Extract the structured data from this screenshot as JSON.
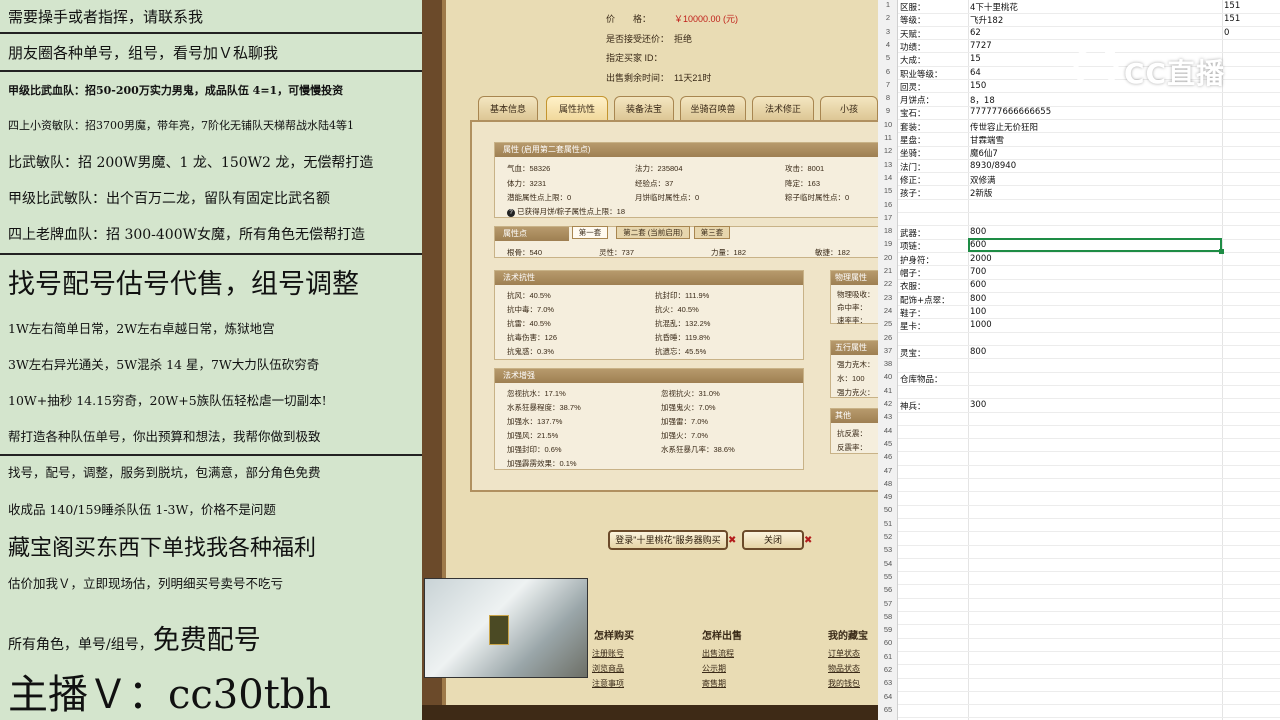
{
  "stream_ads": {
    "lines": [
      "需要操手或者指挥，请联系我",
      "朋友圈各种单号，组号，看号加Ｖ私聊我",
      "甲级比武血队：招50-200万实力男鬼，成品队伍 4=1，可慢慢投资",
      "四上小资敏队：招3700男魔，带年亮，7阶化无铺队天梯帮战水陆4等1",
      "比武敏队：招 200W男魔、1 龙、150W2 龙，无偿帮打造",
      "甲级比武敏队：出个百万二龙，留队有固定比武名额",
      "四上老牌血队：招 300-400W女魔，所有角色无偿帮打造",
      "找号配号估号代售，组号调整",
      "1W左右简单日常，2W左右卓越日常，炼狱地宫",
      "3W左右异光通关，5W混杀 14 星，7W大力队伍砍穷奇",
      "10W+抽秒 14.15穷奇，20W+5族队伍轻松虐一切副本!",
      "帮打造各种队伍单号，你出预算和想法，我帮你做到极致",
      "找号，配号，调整，服务到脱坑，包满意，部分角色免费",
      "收成品 140/159睡杀队伍 1-3W，价格不是问题",
      "藏宝阁买东西下单找我各种福利",
      "估价加我Ｖ，立即现场估，列明细买号卖号不吃亏",
      "所有角色，单号/组号，",
      "免费配号",
      "主播Ｖ：cc30tbh"
    ]
  },
  "trade_panel": {
    "price_label": "价　　格：",
    "price_value": "￥10000.00 (元)",
    "counter_offer_label": "是否接受还价：",
    "counter_offer_value": "拒绝",
    "buyer_label": "指定买家 ID：",
    "time_left_label": "出售剩余时间：",
    "time_left_value": "11天21时",
    "tabs": [
      "基本信息",
      "属性抗性",
      "装备法宝",
      "坐骑召唤兽",
      "法术修正",
      "小孩"
    ],
    "attr_box": {
      "title": "属性 (启用第二套属性点)",
      "rows": [
        [
          "气血：58326",
          "法力：235804",
          "攻击：8001"
        ],
        [
          "体力：3231",
          "经验点：37",
          "降定：163"
        ],
        [
          "潜能属性点上限：0",
          "月饼临时属性点：0",
          "粽子临时属性点：0"
        ]
      ],
      "note": "已获得月饼/粽子属性点上限：18",
      "note_icon": "question-icon"
    },
    "points_box": {
      "title": "属性点",
      "subtabs": [
        "第一套",
        "第二套 (当前启用)",
        "第三套"
      ],
      "row": [
        "根骨：540",
        "灵性：737",
        "力量：182",
        "敏捷：182"
      ]
    },
    "resist_box": {
      "title": "法术抗性",
      "rows": [
        [
          "抗风：40.5%",
          "抗封印：111.9%"
        ],
        [
          "抗中毒：7.0%",
          "抗火：40.5%"
        ],
        [
          "抗雷：40.5%",
          "抗混乱：132.2%"
        ],
        [
          "抗毒伤害：126",
          "抗昏睡：119.8%"
        ],
        [
          "抗鬼惑：0.3%",
          "抗遗忘：45.5%"
        ]
      ]
    },
    "enhance_box": {
      "title": "法术增强",
      "rows": [
        [
          "忽视抗水：17.1%",
          "忽视抗火：31.0%"
        ],
        [
          "水系狂暴程度：38.7%",
          "加强鬼火：7.0%"
        ],
        [
          "加强水：137.7%",
          "加强雷：7.0%"
        ],
        [
          "加强风：21.5%",
          "加强火：7.0%"
        ],
        [
          "加强封印：0.6%",
          "水系狂暴几率：38.6%"
        ],
        [
          "加强霹雳效果：0.1%",
          ""
        ]
      ]
    },
    "side_boxes": [
      {
        "title": "物理属性",
        "rows": [
          "物理吸收：",
          "命中率：",
          "速率率："
        ]
      },
      {
        "title": "五行属性",
        "rows": [
          "强力克木：",
          "水：100",
          "强力克火："
        ]
      },
      {
        "title": "其他",
        "rows": [
          "抗反震：",
          "反震率："
        ]
      }
    ],
    "login_button": "登录\"十里桃花\"服务器购买",
    "close_button": "关闭",
    "footer": {
      "col1_title": "怎样购买",
      "col1_links": [
        "注册账号",
        "浏览商品",
        "注意事项"
      ],
      "col2_title": "怎样出售",
      "col2_links": [
        "出售流程",
        "公示期",
        "寄售期"
      ],
      "col3_title": "我的藏宝",
      "col3_links": [
        "订单状态",
        "物品状态",
        "我的钱包"
      ]
    }
  },
  "spreadsheet": {
    "rows": [
      {
        "n": "1",
        "a": "区服：",
        "b": "4下十里桃花",
        "c": "151"
      },
      {
        "n": "2",
        "a": "等级：",
        "b": "飞升182",
        "c": "151"
      },
      {
        "n": "3",
        "a": "天赋：",
        "b": "62",
        "c": "0"
      },
      {
        "n": "4",
        "a": "功绩：",
        "b": "7727",
        "c": ""
      },
      {
        "n": "5",
        "a": "大成：",
        "b": "15",
        "c": ""
      },
      {
        "n": "6",
        "a": "职业等级：",
        "b": "64",
        "c": ""
      },
      {
        "n": "7",
        "a": "回灵：",
        "b": "150",
        "c": ""
      },
      {
        "n": "8",
        "a": "月饼点：",
        "b": "8，18",
        "c": ""
      },
      {
        "n": "9",
        "a": "宝石：",
        "b": "777777666666655",
        "c": ""
      },
      {
        "n": "10",
        "a": "套装：",
        "b": "传世容止无价狂阳",
        "c": ""
      },
      {
        "n": "11",
        "a": "星盘：",
        "b": "甘霖端雪",
        "c": ""
      },
      {
        "n": "12",
        "a": "坐骑：",
        "b": "魔6仙7",
        "c": ""
      },
      {
        "n": "13",
        "a": "法门：",
        "b": "8930/8940",
        "c": ""
      },
      {
        "n": "14",
        "a": "修正：",
        "b": "双修满",
        "c": ""
      },
      {
        "n": "15",
        "a": "孩子：",
        "b": "2新版",
        "c": ""
      },
      {
        "n": "16",
        "a": "",
        "b": "",
        "c": ""
      },
      {
        "n": "17",
        "a": "",
        "b": "",
        "c": ""
      },
      {
        "n": "18",
        "a": "武器：",
        "b": "800",
        "c": ""
      },
      {
        "n": "19",
        "a": "项链：",
        "b": "600",
        "c": ""
      },
      {
        "n": "20",
        "a": "护身符：",
        "b": "2000",
        "c": ""
      },
      {
        "n": "21",
        "a": "帽子：",
        "b": "700",
        "c": ""
      },
      {
        "n": "22",
        "a": "衣服：",
        "b": "600",
        "c": ""
      },
      {
        "n": "23",
        "a": "配饰+点翠：",
        "b": "800",
        "c": ""
      },
      {
        "n": "24",
        "a": "鞋子：",
        "b": "100",
        "c": ""
      },
      {
        "n": "25",
        "a": "星卡：",
        "b": "1000",
        "c": ""
      },
      {
        "n": "26",
        "a": "",
        "b": "",
        "c": ""
      },
      {
        "n": "37",
        "a": "灵宝：",
        "b": "800",
        "c": ""
      },
      {
        "n": "38",
        "a": "",
        "b": "",
        "c": ""
      },
      {
        "n": "40",
        "a": "仓库物品：",
        "b": "",
        "c": ""
      },
      {
        "n": "41",
        "a": "",
        "b": "",
        "c": ""
      },
      {
        "n": "42",
        "a": "神兵：",
        "b": "300",
        "c": ""
      },
      {
        "n": "43",
        "a": "",
        "b": "",
        "c": ""
      },
      {
        "n": "44",
        "a": "",
        "b": "",
        "c": ""
      },
      {
        "n": "45",
        "a": "",
        "b": "",
        "c": ""
      },
      {
        "n": "46",
        "a": "",
        "b": "",
        "c": ""
      },
      {
        "n": "47",
        "a": "",
        "b": "",
        "c": ""
      },
      {
        "n": "48",
        "a": "",
        "b": "",
        "c": ""
      },
      {
        "n": "49",
        "a": "",
        "b": "",
        "c": ""
      },
      {
        "n": "50",
        "a": "",
        "b": "",
        "c": ""
      },
      {
        "n": "51",
        "a": "",
        "b": "",
        "c": ""
      },
      {
        "n": "52",
        "a": "",
        "b": "",
        "c": ""
      },
      {
        "n": "53",
        "a": "",
        "b": "",
        "c": ""
      },
      {
        "n": "54",
        "a": "",
        "b": "",
        "c": ""
      },
      {
        "n": "55",
        "a": "",
        "b": "",
        "c": ""
      },
      {
        "n": "56",
        "a": "",
        "b": "",
        "c": ""
      },
      {
        "n": "57",
        "a": "",
        "b": "",
        "c": ""
      },
      {
        "n": "58",
        "a": "",
        "b": "",
        "c": ""
      },
      {
        "n": "59",
        "a": "",
        "b": "",
        "c": ""
      },
      {
        "n": "60",
        "a": "",
        "b": "",
        "c": ""
      },
      {
        "n": "61",
        "a": "",
        "b": "",
        "c": ""
      },
      {
        "n": "62",
        "a": "",
        "b": "",
        "c": ""
      },
      {
        "n": "63",
        "a": "",
        "b": "",
        "c": ""
      },
      {
        "n": "64",
        "a": "",
        "b": "",
        "c": ""
      },
      {
        "n": "65",
        "a": "",
        "b": "",
        "c": ""
      }
    ],
    "selected_cell_value": "600"
  },
  "watermark": {
    "text": "CC直播",
    "icon": "cc-logo-icon"
  },
  "colors": {
    "ad_background": "#d4e5cd",
    "game_frame": "#6b4a2a",
    "price_red": "#c0201a",
    "selection_green": "#1e8c45"
  }
}
